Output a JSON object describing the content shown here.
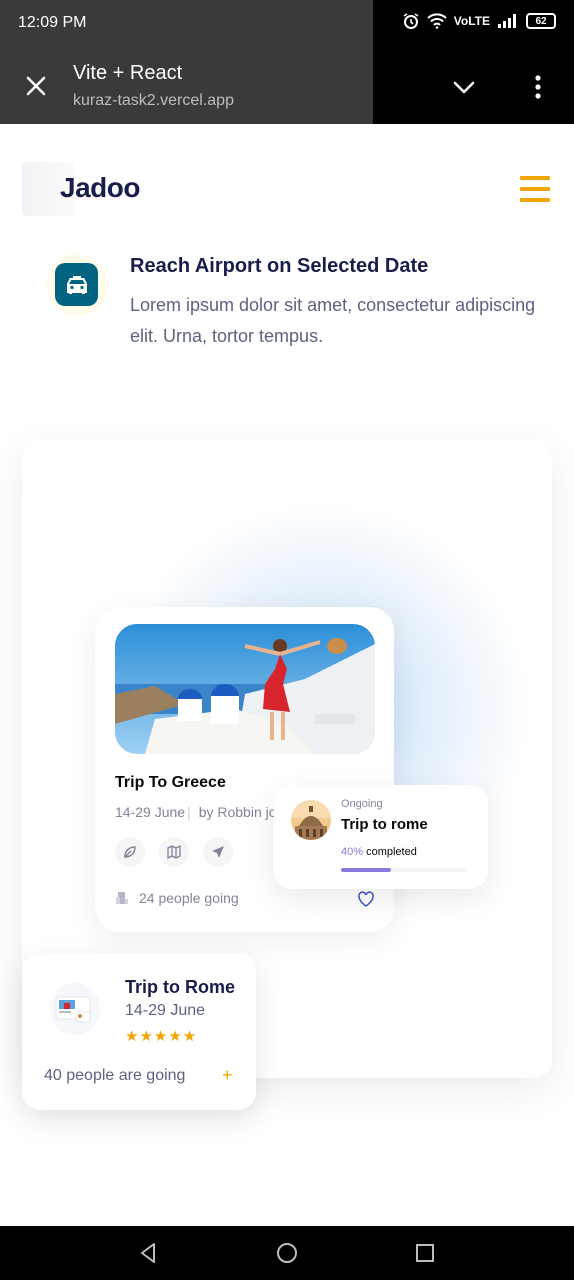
{
  "status_bar": {
    "time": "12:09 PM",
    "volte": "VoLTE",
    "battery": "62"
  },
  "browser": {
    "title": "Vite + React",
    "url": "kuraz-task2.vercel.app"
  },
  "header": {
    "logo": "Jadoo"
  },
  "feature": {
    "title": "Reach Airport on Selected Date",
    "description": "Lorem ipsum dolor sit amet, consectetur adipiscing elit. Urna, tortor tempus."
  },
  "trip_card": {
    "title": "Trip To Greece",
    "dates": "14-29 June",
    "separator": "|",
    "author": "by Robbin jo",
    "going": "24 people going"
  },
  "ongoing_card": {
    "label": "Ongoing",
    "title": "Trip to rome",
    "percent": "40%",
    "completed": "completed",
    "progress": 0.4
  },
  "rome_card": {
    "title": "Trip to Rome",
    "dates": "14-29 June",
    "stars": "★★★★★",
    "going": "40 people are going",
    "plus": "+"
  },
  "colors": {
    "accent": "#f1a501",
    "navy": "#181e4b",
    "teal": "#006380",
    "purple": "#8a79df"
  }
}
